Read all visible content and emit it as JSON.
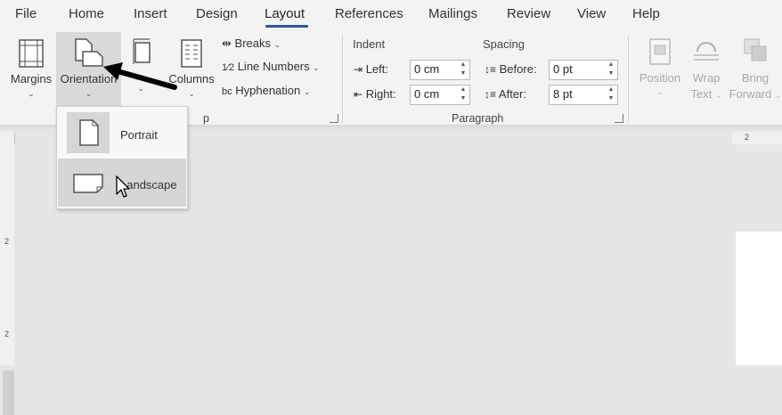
{
  "menu": {
    "tabs": [
      "File",
      "Home",
      "Insert",
      "Design",
      "Layout",
      "References",
      "Mailings",
      "Review",
      "View",
      "Help"
    ],
    "active_tab": "Layout",
    "accent_color": "#2b5797"
  },
  "page_setup": {
    "margins_label": "Margins",
    "orientation_label": "Orientation",
    "columns_label": "Columns",
    "breaks_label": "Breaks",
    "line_numbers_label": "Line Numbers",
    "hyphenation_label": "Hyphenation",
    "group_label_fragment": "p"
  },
  "paragraph": {
    "indent_label": "Indent",
    "spacing_label": "Spacing",
    "left_label": "Left:",
    "right_label": "Right:",
    "before_label": "Before:",
    "after_label": "After:",
    "left_value": "0 cm",
    "right_value": "0 cm",
    "before_value": "0 pt",
    "after_value": "8 pt",
    "group_label": "Paragraph"
  },
  "arrange": {
    "position_label": "Position",
    "wrap_label_1": "Wrap",
    "wrap_label_2": "Text",
    "bring_label_1": "Bring",
    "bring_label_2": "Forward"
  },
  "orientation_menu": {
    "items": [
      {
        "label": "Portrait",
        "icon": "portrait-page-icon",
        "selected": true
      },
      {
        "label": "Landscape",
        "icon": "landscape-page-icon",
        "hovered": true
      }
    ]
  },
  "ruler": {
    "horizontal_mark": "2",
    "vertical_mark_1": "2",
    "vertical_mark_2": "2"
  }
}
